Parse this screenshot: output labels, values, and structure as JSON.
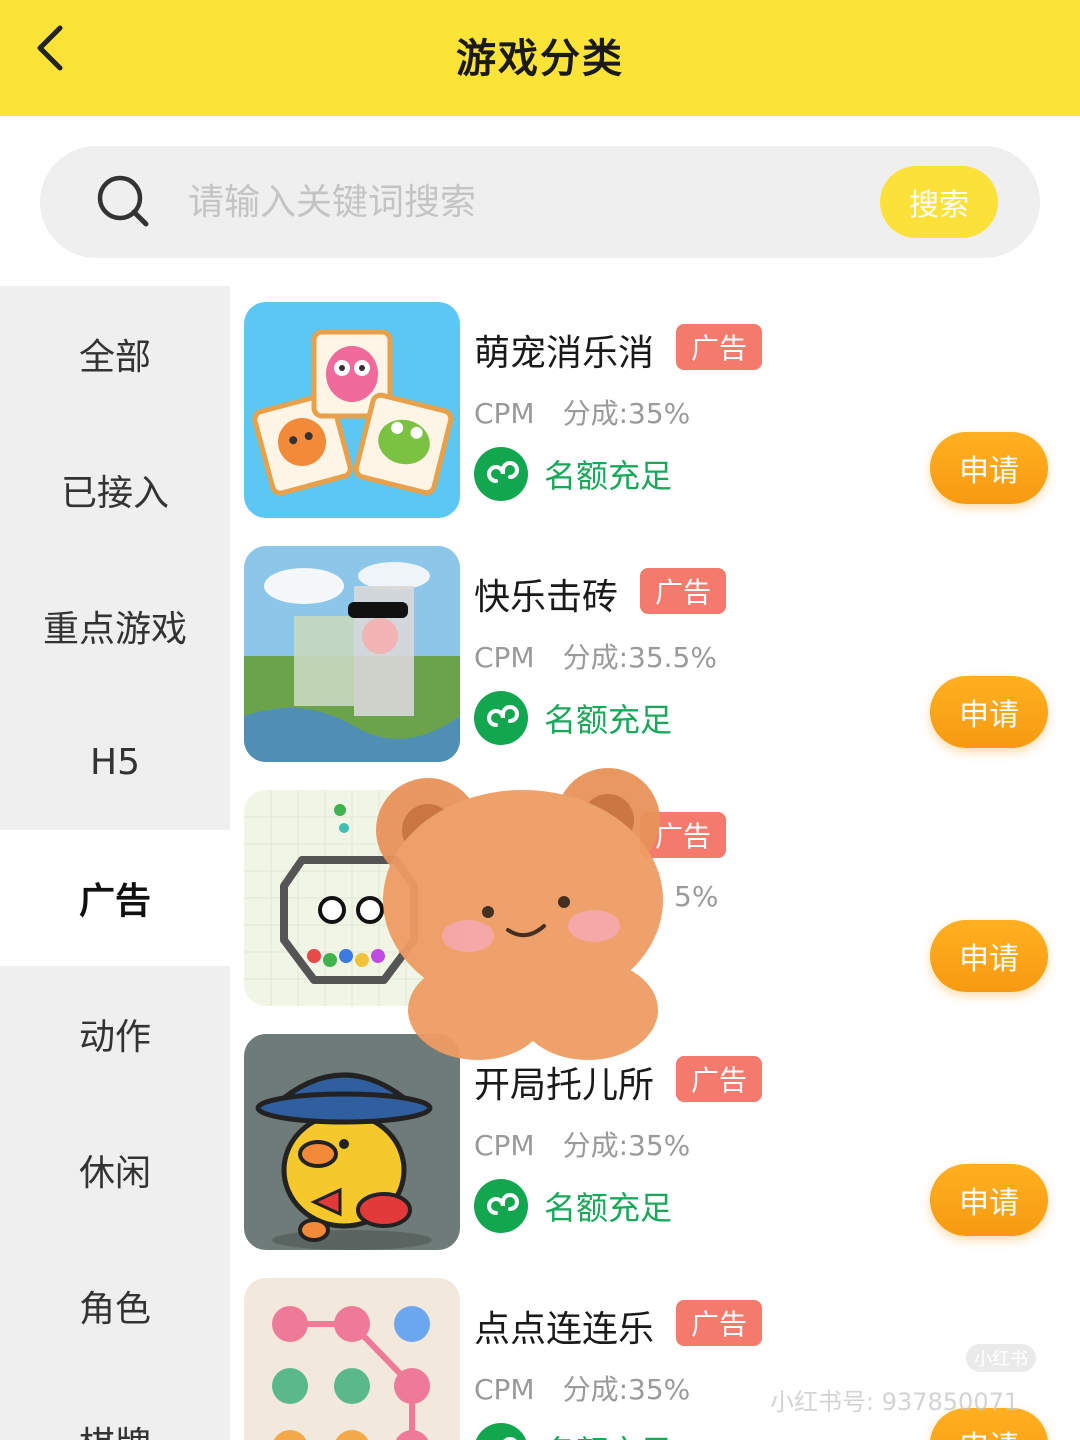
{
  "header": {
    "title": "游戏分类",
    "back_icon": "chevron-left-icon"
  },
  "search": {
    "placeholder": "请输入关键词搜索",
    "value": "",
    "button_label": "搜索",
    "icon": "search-icon"
  },
  "sidebar": {
    "active": "广告",
    "items": [
      {
        "label": "全部"
      },
      {
        "label": "已接入"
      },
      {
        "label": "重点游戏"
      },
      {
        "label": "H5"
      },
      {
        "label": "广告"
      },
      {
        "label": "动作"
      },
      {
        "label": "休闲"
      },
      {
        "label": "角色"
      },
      {
        "label": "棋牌"
      }
    ]
  },
  "games": [
    {
      "name": "萌宠消乐消",
      "badge": "广告",
      "cpm_label": "CPM",
      "share": "分成:35%",
      "quota": "名额充足",
      "apply_label": "申请"
    },
    {
      "name": "快乐击砖",
      "badge": "广告",
      "cpm_label": "CPM",
      "share": "分成:35.5%",
      "quota": "名额充足",
      "apply_label": "申请"
    },
    {
      "name": "",
      "badge": "广告",
      "cpm_label": "",
      "share": "5%",
      "quota": "",
      "apply_label": "申请"
    },
    {
      "name": "开局托儿所",
      "badge": "广告",
      "cpm_label": "CPM",
      "share": "分成:35%",
      "quota": "名额充足",
      "apply_label": "申请"
    },
    {
      "name": "点点连连乐",
      "badge": "广告",
      "cpm_label": "CPM",
      "share": "分成:35%",
      "quota": "名额充足",
      "apply_label": "申请"
    }
  ],
  "colors": {
    "header_bg": "#fbe337",
    "search_button": "#fbe13a",
    "badge": "#f47a6d",
    "apply": "#f9a118",
    "quota": "#19a85a"
  },
  "overlay": {
    "sticker": "bear-sticker",
    "watermark": "小红书号: 937850071",
    "watermark_logo": "小红书"
  }
}
